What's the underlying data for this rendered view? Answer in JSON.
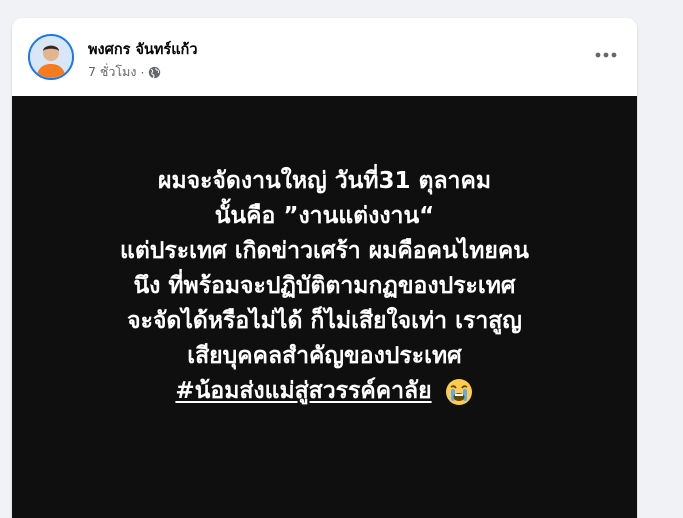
{
  "post": {
    "author_name": "พงศกร จันทร์แก้ว",
    "timestamp": "7 ชั่วโมง",
    "meta_separator": "·",
    "privacy_icon": "globe-icon",
    "more_icon": "more-options-icon",
    "text_lines": [
      "ผมจะจัดงานใหญ่ วันที่31 ตุลาคม",
      "นั้นคือ ”งานแต่งงาน“",
      "แต่ประเทศ เกิดข่าวเศร้า ผมคือคนไทยคน",
      "นึง ที่พร้อมจะปฏิบัติตามกฏของประเทศ",
      "จะจัดได้หรือไม่ได้ ก็ไม่เสียใจเท่า เราสูญ",
      "เสียบุคคลสำคัญของประเทศ"
    ],
    "hashtag": "#น้อมส่งแม่สู่สวรรค์คาลัย",
    "emoji": "loudly-crying-face-icon"
  },
  "colors": {
    "page_background": "#f0f2f5",
    "card_background": "#ffffff",
    "media_background": "#0f0f0f",
    "avatar_ring": "#1877f2",
    "avatar_shirt": "#f57c1f",
    "secondary_text": "#65676b"
  }
}
